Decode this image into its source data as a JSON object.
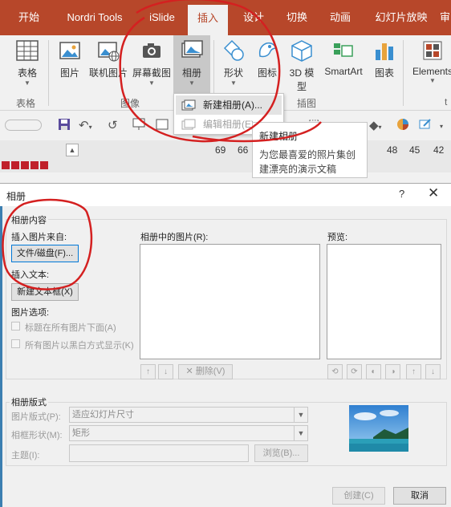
{
  "ribbon": {
    "tabs": [
      {
        "label": "开始",
        "active": false
      },
      {
        "label": "Nordri Tools",
        "active": false
      },
      {
        "label": "iSlide",
        "active": false
      },
      {
        "label": "插入",
        "active": true
      },
      {
        "label": "设计",
        "active": false
      },
      {
        "label": "切换",
        "active": false
      },
      {
        "label": "动画",
        "active": false
      },
      {
        "label": "幻灯片放映",
        "active": false
      },
      {
        "label": "审",
        "active": false
      }
    ],
    "buttons": {
      "table": "表格",
      "picture": "图片",
      "online_picture": "联机图片",
      "screenshot": "屏幕截图",
      "album": "相册",
      "shapes": "形状",
      "icons": "图标",
      "model3d_line1": "3D 模",
      "model3d_line2": "型",
      "smartart": "SmartArt",
      "chart": "图表",
      "elements": "Elements"
    },
    "groups": {
      "tables": "表格",
      "images": "图像",
      "illustrations": "插图",
      "t": "t"
    },
    "album_menu": {
      "new_album": "新建相册(A)...",
      "edit_album": "编辑相册(E)..."
    },
    "tooltip": {
      "title": "新建相册",
      "desc_line1": "为您最喜爱的照片集创",
      "desc_line2": "建漂亮的演示文稿"
    },
    "ruler": [
      "69",
      "66",
      "48",
      "45",
      "42"
    ]
  },
  "dialog": {
    "title": "相册",
    "help": "?",
    "close": "✕",
    "album_content": "相册内容",
    "insert_from": "插入图片来自:",
    "file_disk": "文件/磁盘(F)...",
    "insert_text": "插入文本:",
    "new_textbox": "新建文本框(X)",
    "picture_options": "图片选项:",
    "caption_below": "标题在所有图片下面(A)",
    "all_black_white": "所有图片以黑白方式显示(K)",
    "pictures_in_album": "相册中的图片(R):",
    "preview": "预览:",
    "up": "↑",
    "down": "↓",
    "remove": "删除(V)",
    "album_layout": "相册版式",
    "picture_layout_label": "图片版式(P):",
    "picture_layout_value": "适应幻灯片尺寸",
    "frame_shape_label": "相框形状(M):",
    "frame_shape_value": "矩形",
    "theme_label": "主题(I):",
    "browse": "浏览(B)...",
    "create": "创建(C)",
    "cancel": "取消"
  },
  "colors": {
    "accent": "#b7472a",
    "annotation": "#d42020"
  }
}
